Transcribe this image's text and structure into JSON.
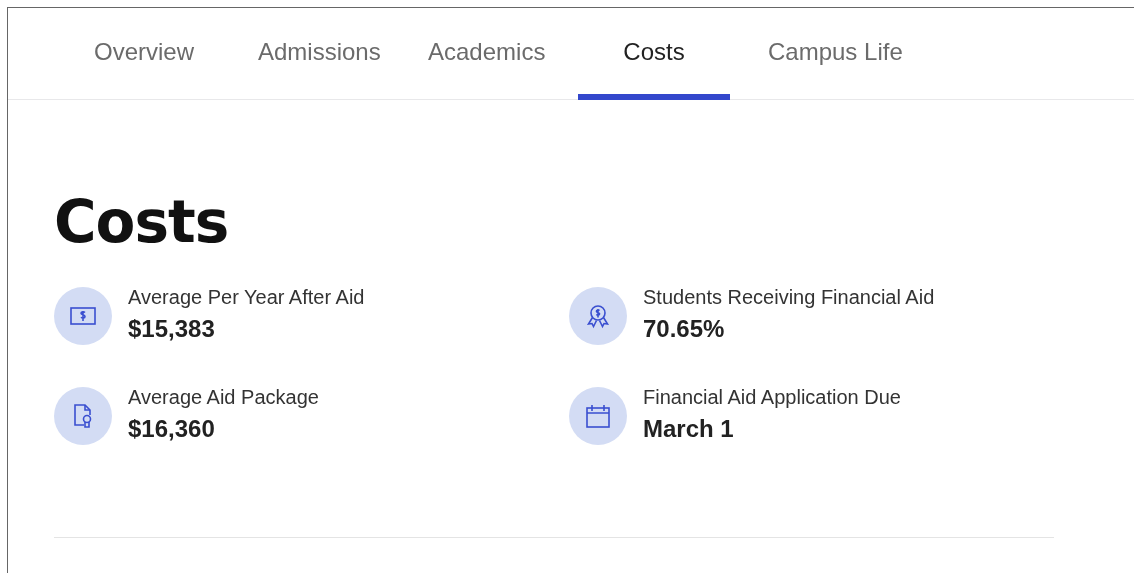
{
  "tabs": [
    {
      "label": "Overview",
      "selected": false
    },
    {
      "label": "Admissions",
      "selected": false
    },
    {
      "label": "Academics",
      "selected": false
    },
    {
      "label": "Costs",
      "selected": true
    },
    {
      "label": "Campus Life",
      "selected": false
    }
  ],
  "heading": "Costs",
  "stats": [
    {
      "kind": "bill",
      "label": "Average Per Year After Aid",
      "value": "$15,383"
    },
    {
      "kind": "award",
      "label": "Students Receiving Financial Aid",
      "value": "70.65%"
    },
    {
      "kind": "document",
      "label": "Average Aid Package",
      "value": "$16,360"
    },
    {
      "kind": "calendar",
      "label": "Financial Aid Application Due",
      "value": "March 1"
    }
  ]
}
